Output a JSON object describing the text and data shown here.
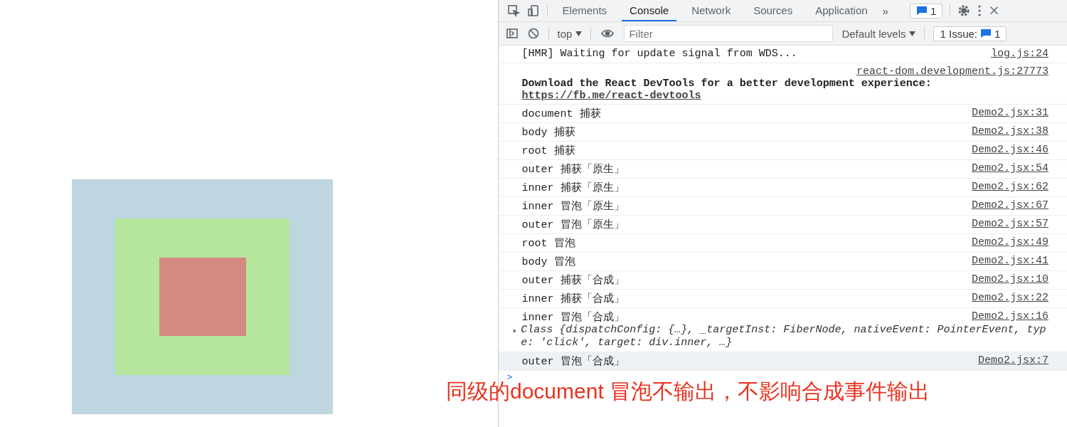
{
  "devtools": {
    "tools": [
      {
        "kind": "inspect"
      },
      {
        "kind": "device"
      }
    ],
    "tabs": [
      {
        "label": "Elements",
        "selected": false
      },
      {
        "label": "Console",
        "selected": true
      },
      {
        "label": "Network",
        "selected": false
      },
      {
        "label": "Sources",
        "selected": false
      },
      {
        "label": "Application",
        "selected": false
      }
    ],
    "more_tabs": "»",
    "messages_badge": "1",
    "console_toolbar": {
      "context": "top",
      "filter_placeholder": "Filter",
      "levels": "Default levels",
      "issues_label": "1 Issue:",
      "issues_count": "1"
    }
  },
  "console": {
    "messages": [
      {
        "kind": "log",
        "text": "[HMR] Waiting for update signal from WDS...",
        "source": "log.js:24",
        "highlighted": false
      },
      {
        "kind": "notice",
        "text": "Download the React DevTools for a better development experience: ",
        "link": "https://fb.me/react-devtools",
        "source": "react-dom.development.js:27773",
        "highlighted": false
      },
      {
        "kind": "log",
        "text": "document 捕获",
        "source": "Demo2.jsx:31",
        "highlighted": false
      },
      {
        "kind": "log",
        "text": "body 捕获",
        "source": "Demo2.jsx:38",
        "highlighted": false
      },
      {
        "kind": "log",
        "text": "root 捕获",
        "source": "Demo2.jsx:46",
        "highlighted": false
      },
      {
        "kind": "log",
        "text": "outer 捕获「原生」",
        "source": "Demo2.jsx:54",
        "highlighted": false
      },
      {
        "kind": "log",
        "text": "inner 捕获「原生」",
        "source": "Demo2.jsx:62",
        "highlighted": false
      },
      {
        "kind": "log",
        "text": "inner 冒泡「原生」",
        "source": "Demo2.jsx:67",
        "highlighted": false
      },
      {
        "kind": "log",
        "text": "outer 冒泡「原生」",
        "source": "Demo2.jsx:57",
        "highlighted": false
      },
      {
        "kind": "log",
        "text": "root 冒泡",
        "source": "Demo2.jsx:49",
        "highlighted": false
      },
      {
        "kind": "log",
        "text": "body 冒泡",
        "source": "Demo2.jsx:41",
        "highlighted": false
      },
      {
        "kind": "log",
        "text": "outer 捕获「合成」",
        "source": "Demo2.jsx:10",
        "highlighted": false
      },
      {
        "kind": "log",
        "text": "inner 捕获「合成」",
        "source": "Demo2.jsx:22",
        "highlighted": false
      },
      {
        "kind": "object",
        "text": "inner 冒泡「合成」",
        "object": "Class {dispatchConfig: {…}, _targetInst: FiberNode, nativeEvent: PointerEvent, type: 'click', target: div.inner, …}",
        "source": "Demo2.jsx:16",
        "highlighted": false
      },
      {
        "kind": "log",
        "text": "outer 冒泡「合成」",
        "source": "Demo2.jsx:7",
        "highlighted": true
      }
    ],
    "prompt": ">"
  },
  "caption": "同级的document 冒泡不输出，不影响合成事件输出"
}
